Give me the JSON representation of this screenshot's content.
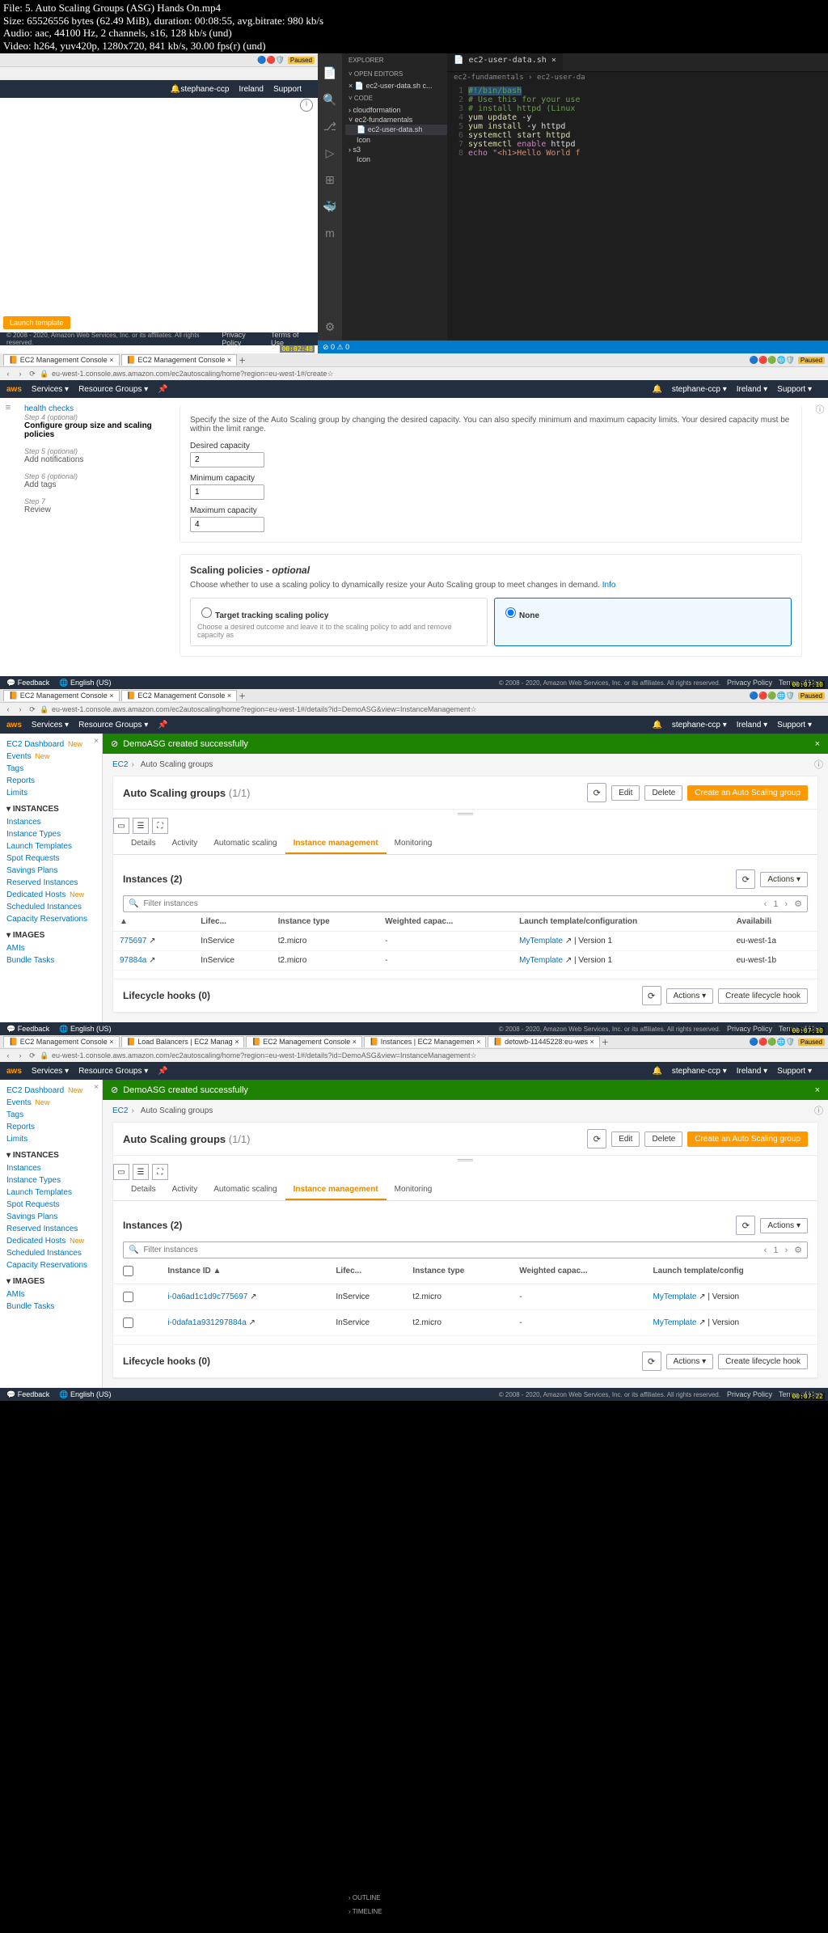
{
  "file_info": {
    "file": "File: 5. Auto Scaling Groups (ASG) Hands On.mp4",
    "size": "Size: 65526556 bytes (62.49 MiB), duration: 00:08:55, avg.bitrate: 980 kb/s",
    "audio": "Audio: aac, 44100 Hz, 2 channels, s16, 128 kb/s (und)",
    "video": "Video: h264, yuv420p, 1280x720, 841 kb/s, 30.00 fps(r) (und)"
  },
  "browser": {
    "tab1": "EC2 Management Console",
    "tab2": "EC2 Management Console",
    "tab_lb": "Load Balancers | EC2 Manag",
    "tab_inst": "Instances | EC2 Managemen",
    "tab_det": "detowb-11445228:eu-wes",
    "url1": "eu-west-1.console.aws.amazon.com/ec2autoscaling/home?region=eu-west-1#/create",
    "url2": "eu-west-1.console.aws.amazon.com/ec2autoscaling/home?region=eu-west-1#/details?id=DemoASG&view=InstanceManagement",
    "url3": "eu-west-1.console.aws.amazon.com/ec2autoscaling/home?region=eu-west-1#/details?id=DemoASG&view=InstanceManagement",
    "paused": "Paused"
  },
  "aws_header": {
    "logo": "aws",
    "services": "Services",
    "resource_groups": "Resource Groups",
    "user": "stephane-ccp",
    "region": "Ireland",
    "support": "Support"
  },
  "footer": {
    "feedback": "Feedback",
    "lang": "English (US)",
    "copy": "© 2008 - 2020, Amazon Web Services, Inc. or its affiliates. All rights reserved.",
    "privacy": "Privacy Policy",
    "terms": "Terms of Use"
  },
  "launch_template_btn": "Launch template",
  "vscode": {
    "explorer": "EXPLORER",
    "open_editors": "OPEN EDITORS",
    "open_file": "ec2-user-data.sh c...",
    "code_section": "CODE",
    "folders": {
      "cloudformation": "cloudformation",
      "ec2fund": "ec2-fundamentals",
      "userdata": "ec2-user-data.sh",
      "icon": "Icon",
      "s3": "s3"
    },
    "outline": "OUTLINE",
    "timeline": "TIMELINE",
    "tab": "ec2-user-data.sh",
    "crumbs": "ec2-fundamentals › ec2-user-da",
    "lines": {
      "l1": "#!/bin/bash",
      "l2": "# Use this for your use",
      "l3": "# install httpd (Linux",
      "l4a": "yum update ",
      "l4b": "-y",
      "l5a": "yum install ",
      "l5b": "-y httpd",
      "l6": "systemctl start httpd",
      "l7a": "systemctl ",
      "l7b": "enable",
      "l7c": " httpd",
      "l8a": "echo ",
      "l8b": "\"<h1>Hello World f"
    },
    "status_warn": "⊘ 0 ⚠ 0"
  },
  "wizard": {
    "steps": {
      "health": "health checks",
      "s4o": "Step 4 (optional)",
      "s4t": "Configure group size and scaling policies",
      "s5o": "Step 5 (optional)",
      "s5t": "Add notifications",
      "s6o": "Step 6 (optional)",
      "s6t": "Add tags",
      "s7o": "Step 7",
      "s7t": "Review"
    },
    "desc": "Specify the size of the Auto Scaling group by changing the desired capacity. You can also specify minimum and maximum capacity limits. Your desired capacity must be within the limit range.",
    "desired_lbl": "Desired capacity",
    "desired_val": "2",
    "min_lbl": "Minimum capacity",
    "min_val": "1",
    "max_lbl": "Maximum capacity",
    "max_val": "4",
    "scaling_title": "Scaling policies - ",
    "scaling_opt": "optional",
    "scaling_desc": "Choose whether to use a scaling policy to dynamically resize your Auto Scaling group to meet changes in demand.",
    "info": "Info",
    "target_title": "Target tracking scaling policy",
    "target_desc": "Choose a desired outcome and leave it to the scaling policy to add and remove capacity as",
    "none": "None"
  },
  "asg": {
    "alert": "DemoASG created successfully",
    "crumb1": "EC2",
    "crumb2": "Auto Scaling groups",
    "title": "Auto Scaling groups",
    "count": "(1/1)",
    "edit": "Edit",
    "delete": "Delete",
    "create": "Create an Auto Scaling group",
    "tabs": {
      "details": "Details",
      "activity": "Activity",
      "autoscaling": "Automatic scaling",
      "instmgmt": "Instance management",
      "monitoring": "Monitoring"
    },
    "inst_title": "Instances",
    "inst_count": "(2)",
    "actions": "Actions",
    "filter_ph": "Filter instances",
    "cols": {
      "instid": "Instance ID",
      "life": "Lifec...",
      "type": "Instance type",
      "weight": "Weighted capac...",
      "launch": "Launch template/configuration",
      "launch2": "Launch template/config",
      "avail": "Availabili"
    },
    "rows": [
      {
        "id": "775697",
        "idfull": "i-0a6ad1c1d9c775697",
        "life": "InService",
        "type": "t2.micro",
        "weight": "-",
        "tmpl": "MyTemplate",
        "ver": "| Version 1",
        "vershort": "| Version",
        "avail": "eu-west-1a"
      },
      {
        "id": "97884a",
        "idfull": "i-0dafa1a931297884a",
        "life": "InService",
        "type": "t2.micro",
        "weight": "-",
        "tmpl": "MyTemplate",
        "ver": "| Version 1",
        "vershort": "| Version",
        "avail": "eu-west-1b"
      }
    ],
    "hooks_title": "Lifecycle hooks",
    "hooks_count": "(0)",
    "create_hook": "Create lifecycle hook"
  },
  "ec2_sidebar": {
    "dashboard": "EC2 Dashboard",
    "new": "New",
    "events": "Events",
    "tags": "Tags",
    "reports": "Reports",
    "limits": "Limits",
    "instances_hdr": "INSTANCES",
    "instances": "Instances",
    "instance_types": "Instance Types",
    "launch_templates": "Launch Templates",
    "spot": "Spot Requests",
    "savings": "Savings Plans",
    "reserved": "Reserved Instances",
    "dedicated": "Dedicated Hosts",
    "scheduled": "Scheduled Instances",
    "capacity": "Capacity Reservations",
    "images_hdr": "IMAGES",
    "amis": "AMIs",
    "bundle": "Bundle Tasks"
  },
  "timestamps": {
    "t1": "00:02:48",
    "t2": "00:07:10",
    "t3": "00:07:22"
  }
}
